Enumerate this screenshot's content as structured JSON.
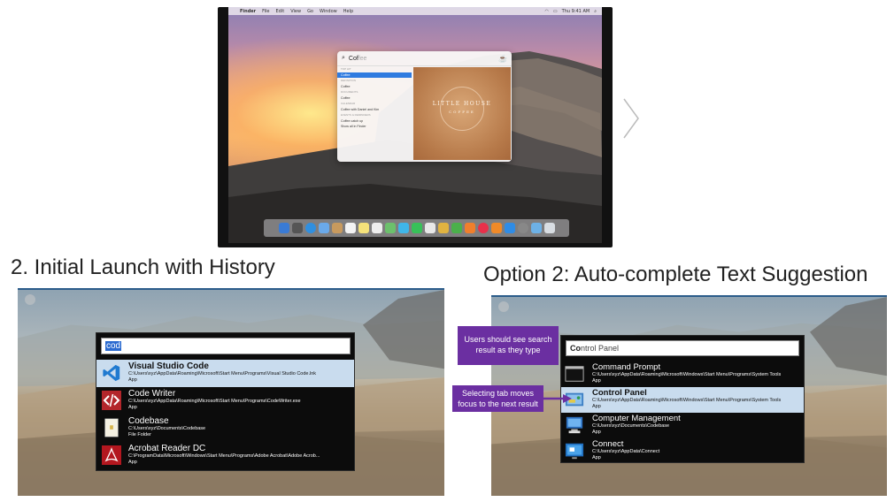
{
  "top_screenshot": {
    "menubar": {
      "apple": "",
      "app": "Finder",
      "items": [
        "File",
        "Edit",
        "View",
        "Go",
        "Window",
        "Help"
      ],
      "clock": "Thu 9:41 AM"
    },
    "spotlight": {
      "typed": "Cof",
      "ghost": "fee",
      "list": [
        {
          "text": "TOP HIT",
          "kind": "hdr"
        },
        {
          "text": "Coffee",
          "kind": "sel"
        },
        {
          "text": "DEFINITION",
          "kind": "hdr"
        },
        {
          "text": "Coffee",
          "kind": "row"
        },
        {
          "text": "DOCUMENTS",
          "kind": "hdr"
        },
        {
          "text": "Coffee",
          "kind": "row"
        },
        {
          "text": "CALENDAR",
          "kind": "hdr"
        },
        {
          "text": "Coffee with Daniel and Kim",
          "kind": "row"
        },
        {
          "text": "EVENTS & REMINDERS",
          "kind": "hdr"
        },
        {
          "text": "Coffee catch up",
          "kind": "row"
        },
        {
          "text": "Show all in Finder",
          "kind": "row"
        }
      ],
      "preview_title": "LITTLE HOUSE",
      "preview_sub": "COFFEE"
    }
  },
  "headings": {
    "left": "2. Initial Launch with History",
    "right": "Option 2: Auto-complete Text Suggestion"
  },
  "left_launcher": {
    "search_text": "cod",
    "results": [
      {
        "title": "Visual Studio Code",
        "path": "C:\\Users\\xyz\\AppData\\Roaming\\Microsoft\\Start Menu\\Programs\\Visual Studio Code.lnk",
        "type": "App",
        "icon": "vscode-icon",
        "selected": true
      },
      {
        "title": "Code Writer",
        "path": "C:\\Users\\xyz\\AppData\\Roaming\\Microsoft\\Start Menu\\Programs\\CodeWriter.exe",
        "type": "App",
        "icon": "code-writer-icon",
        "selected": false
      },
      {
        "title": "Codebase",
        "path": "C:\\Users\\xyz\\Documents\\Codebase",
        "type": "File Folder",
        "icon": "folder-icon",
        "selected": false
      },
      {
        "title": "Acrobat Reader DC",
        "path": "C:\\ProgramData\\Microsoft\\Windows\\Start Menu\\Programs\\Adobe Acrobat\\Adobe Acrob...",
        "type": "App",
        "icon": "acrobat-icon",
        "selected": false
      }
    ]
  },
  "right_launcher": {
    "typed": "Co",
    "suggestion": "ntrol Panel",
    "results": [
      {
        "title": "Command Prompt",
        "path": "C:\\Users\\xyz\\AppData\\Roaming\\Microsoft\\Windows\\Start Menu\\Programs\\System Tools",
        "type": "App",
        "icon": "command-prompt-icon",
        "selected": false
      },
      {
        "title": "Control Panel",
        "path": "C:\\Users\\xyz\\AppData\\Roaming\\Microsoft\\Windows\\Start Menu\\Programs\\System Tools",
        "type": "App",
        "icon": "control-panel-icon",
        "selected": true
      },
      {
        "title": "Computer Management",
        "path": "C:\\Users\\xyz\\Documents\\Codebase",
        "type": "App",
        "icon": "computer-management-icon",
        "selected": false
      },
      {
        "title": "Connect",
        "path": "C:\\Users\\xyz\\AppData\\Connect",
        "type": "App",
        "icon": "connect-icon",
        "selected": false
      }
    ]
  },
  "callouts": {
    "first": "Users should see search result as they type",
    "second": "Selecting tab moves focus to the next result"
  },
  "colors": {
    "callout": "#6b2fa1",
    "selection": "#c9dcee",
    "launcher_bg": "#0c0c0c",
    "title_bar": "#2b5c8a"
  }
}
